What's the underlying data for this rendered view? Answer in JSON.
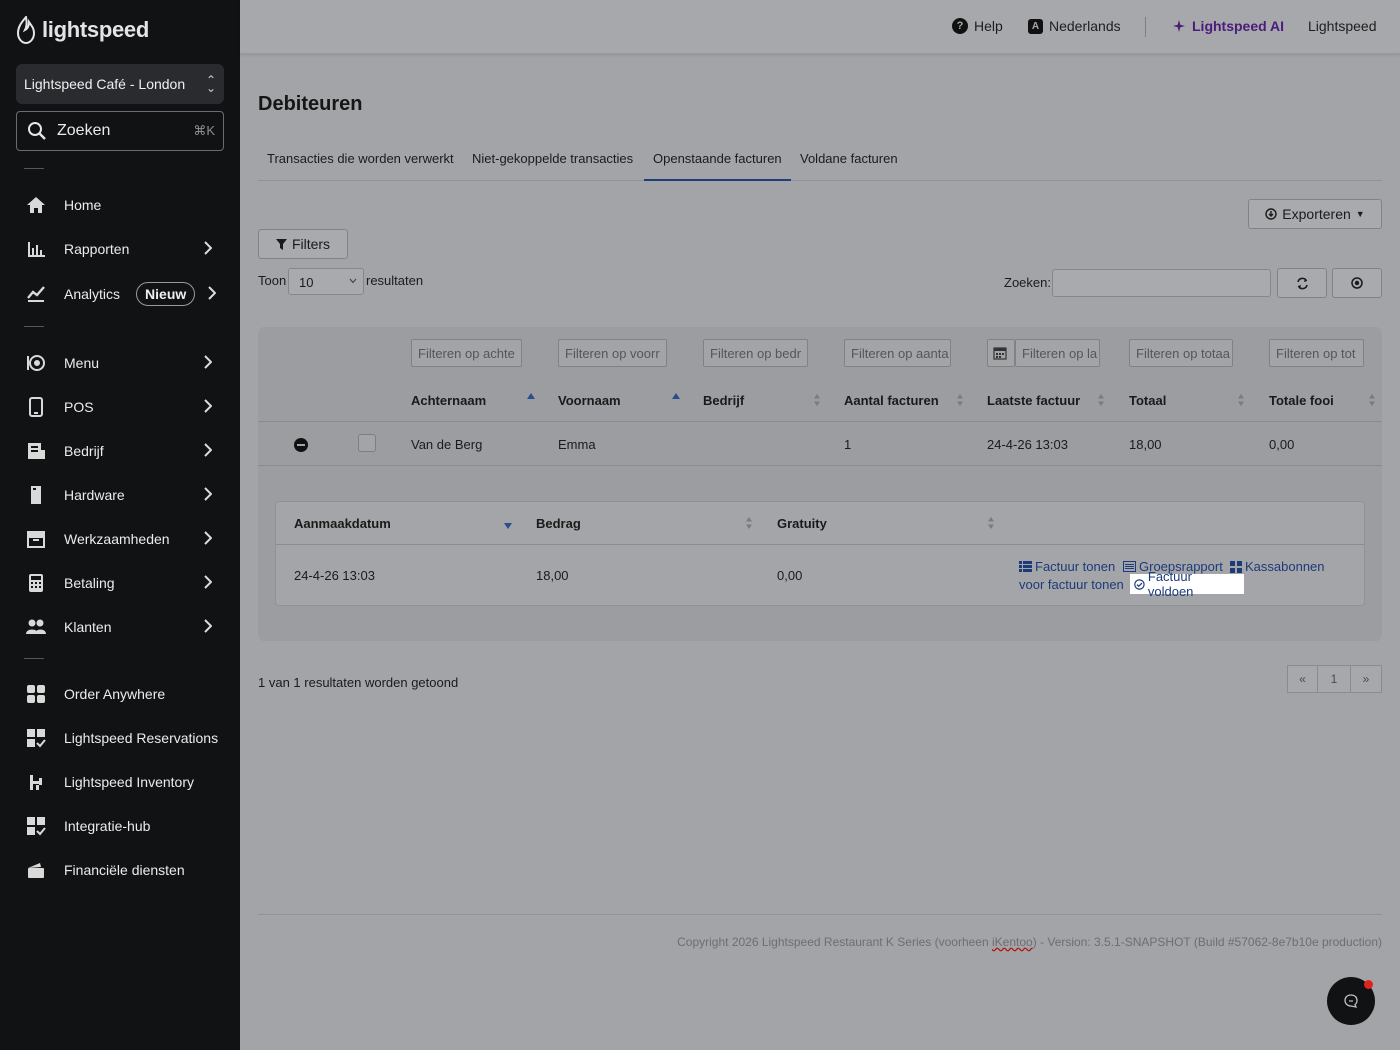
{
  "sidebar": {
    "logo": "lightspeed",
    "store": "Lightspeed Café - London",
    "search": {
      "label": "Zoeken",
      "shortcut": "⌘K"
    },
    "items": [
      {
        "label": "Home",
        "icon": "home-icon"
      },
      {
        "label": "Rapporten",
        "icon": "bar-chart-icon"
      },
      {
        "label": "Analytics",
        "icon": "line-chart-icon",
        "badge": "Nieuw"
      },
      {
        "label": "Menu",
        "icon": "menu-icon"
      },
      {
        "label": "POS",
        "icon": "tablet-icon"
      },
      {
        "label": "Bedrijf",
        "icon": "business-icon"
      },
      {
        "label": "Hardware",
        "icon": "hardware-icon"
      },
      {
        "label": "Werkzaamheden",
        "icon": "archive-icon"
      },
      {
        "label": "Betaling",
        "icon": "calculator-icon"
      },
      {
        "label": "Klanten",
        "icon": "users-icon"
      },
      {
        "label": "Order Anywhere",
        "icon": "grid-icon"
      },
      {
        "label": "Lightspeed Reservations",
        "icon": "reservations-icon"
      },
      {
        "label": "Lightspeed Inventory",
        "icon": "inventory-icon"
      },
      {
        "label": "Integratie-hub",
        "icon": "integrations-icon"
      },
      {
        "label": "Financiële diensten",
        "icon": "wallet-icon"
      }
    ]
  },
  "topbar": {
    "help": "Help",
    "language": "Nederlands",
    "ai": "Lightspeed AI",
    "user": "Lightspeed"
  },
  "page": {
    "title": "Debiteuren",
    "tabs": [
      "Transacties die worden verwerkt",
      "Niet-gekoppelde transacties",
      "Openstaande facturen",
      "Voldane facturen"
    ],
    "active_tab": "Openstaande facturen",
    "export_label": "Exporteren",
    "filters_label": "Filters",
    "show_label": "Toon",
    "page_size": "10",
    "results_label": "resultaten",
    "search_label": "Zoeken:"
  },
  "table": {
    "filter_placeholders": [
      "Filteren op achte",
      "Filteren op voorr",
      "Filteren op bedr",
      "Filteren op aanta",
      "Filteren op la",
      "Filteren op totaa",
      "Filteren op tot"
    ],
    "columns": [
      "Achternaam",
      "Voornaam",
      "Bedrijf",
      "Aantal facturen",
      "Laatste factuur",
      "Totaal",
      "Totale fooi"
    ],
    "rows": [
      {
        "achternaam": "Van de Berg",
        "voornaam": "Emma",
        "bedrijf": "",
        "aantal": "1",
        "laatste": "24-4-26 13:03",
        "totaal": "18,00",
        "fooi": "0,00"
      }
    ]
  },
  "detail": {
    "columns": [
      "Aanmaakdatum",
      "Bedrag",
      "Gratuity"
    ],
    "row": {
      "datum": "24-4-26 13:03",
      "bedrag": "18,00",
      "gratuity": "0,00"
    },
    "actions": {
      "show_invoice": "Factuur tonen",
      "group_report": "Groepsrapport",
      "receipts_a": "Kassabonnen",
      "receipts_b": "voor factuur tonen",
      "pay_invoice": "Factuur voldoen"
    }
  },
  "summary": "1 van 1 resultaten worden getoond",
  "pagination": {
    "prev": "«",
    "current": "1",
    "next": "»"
  },
  "footer": {
    "pre": "Copyright 2026 Lightspeed Restaurant K Series (voorheen ",
    "brand": "iKentoo",
    "post": ") - Version: 3.5.1-SNAPSHOT (Build #57062-8e7b10e production)"
  }
}
